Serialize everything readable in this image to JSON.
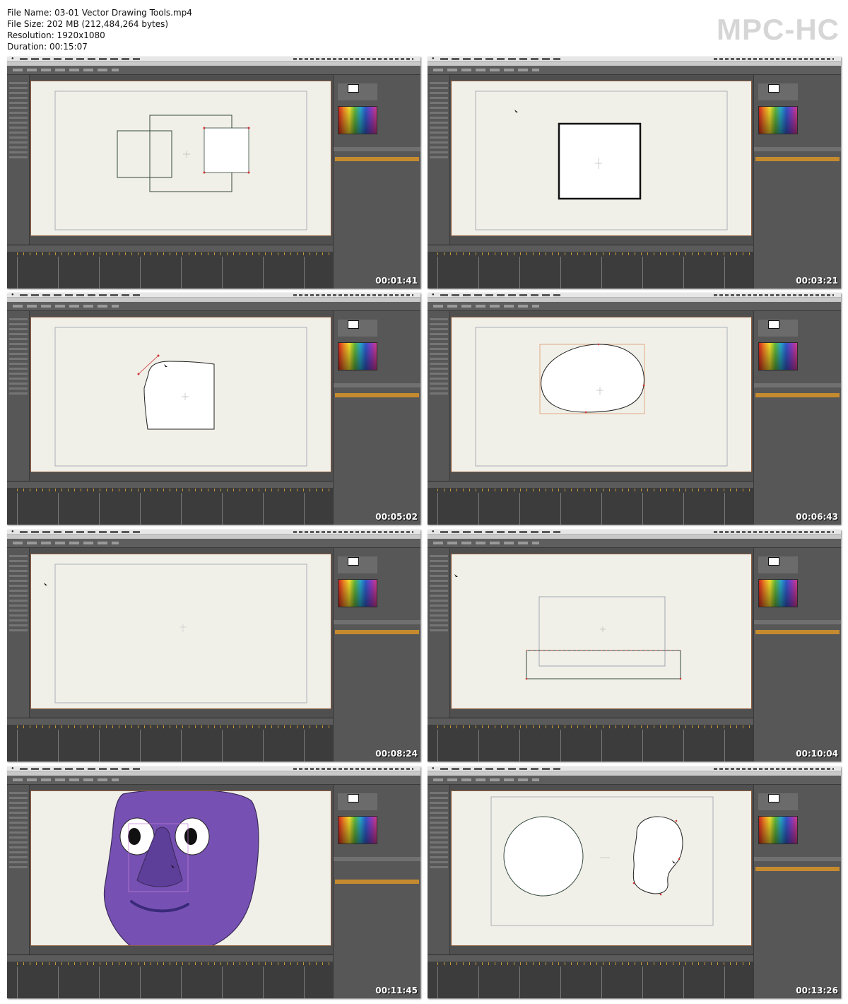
{
  "file_info": {
    "name_line": "File Name: 03-01 Vector Drawing Tools.mp4",
    "size_line": "File Size: 202 MB (212,484,264 bytes)",
    "resolution_line": "Resolution: 1920x1080",
    "duration_line": "Duration: 00:15:07"
  },
  "player_logo": "MPC-HC",
  "thumbnails": [
    {
      "timestamp": "00:01:41",
      "content": "three-rectangles"
    },
    {
      "timestamp": "00:03:21",
      "content": "square-heavy-outline"
    },
    {
      "timestamp": "00:05:02",
      "content": "freehand-quad"
    },
    {
      "timestamp": "00:06:43",
      "content": "blob-shape"
    },
    {
      "timestamp": "00:08:24",
      "content": "empty-canvas"
    },
    {
      "timestamp": "00:10:04",
      "content": "rectangle-with-points"
    },
    {
      "timestamp": "00:11:45",
      "content": "purple-face"
    },
    {
      "timestamp": "00:13:26",
      "content": "circle-and-ear"
    }
  ],
  "colors": {
    "face_purple": "#7651b3",
    "nose_purple": "#5d3e99",
    "layer_highlight": "#c58a2e",
    "canvas_bg": "#f1f0e8"
  }
}
